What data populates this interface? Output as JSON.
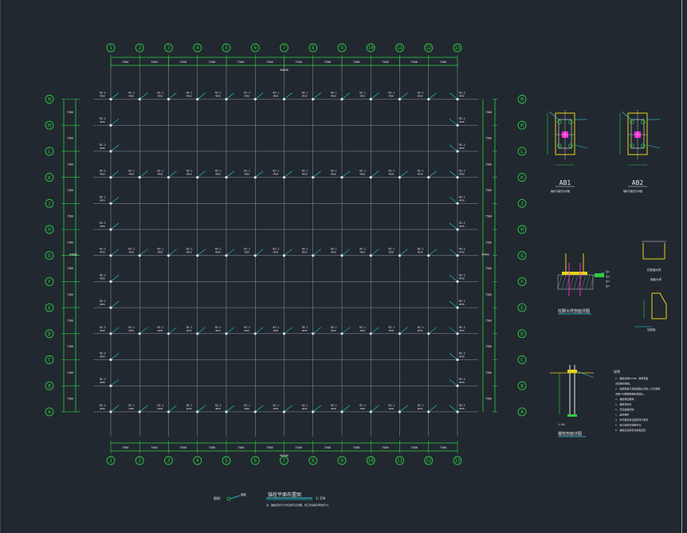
{
  "drawing": {
    "columns": [
      "1",
      "2",
      "3",
      "4",
      "5",
      "6",
      "7",
      "8",
      "9",
      "10",
      "11",
      "12",
      "13"
    ],
    "rows_top_to_bottom": [
      "N",
      "M",
      "L",
      "K",
      "J",
      "H",
      "G",
      "F",
      "E",
      "D",
      "C",
      "B",
      "A"
    ],
    "bay_dim_top": [
      "7500",
      "7500",
      "7500",
      "7500",
      "7500",
      "7500",
      "7500",
      "7500",
      "7500",
      "7500",
      "7500",
      "7500"
    ],
    "bay_dim_bottom": [
      "7500",
      "7500",
      "7500",
      "7500",
      "7500",
      "7500",
      "7500",
      "7500",
      "7500",
      "7500",
      "7500",
      "7500"
    ],
    "overall_dim": "90000",
    "row_dim": "7500",
    "overall_row_dim": "84000",
    "bolt_tag": "RZ-1",
    "bolt_tag_edge": "RZ-2",
    "bolt_callout": "4M30",
    "plan_title": "锚栓平面布置图",
    "plan_scale": "1:150",
    "plan_note": "注：锚栓定位尺寸详见各节点详图，施工时请核对现场尺寸。",
    "legend_mark": "锚栓",
    "legend_label": "图例："
  },
  "details": {
    "ab1_label": "AB1",
    "ab2_label": "AB2",
    "ab1_note": "锚栓平面定位详图",
    "ab2_note": "锚栓平面定位详图",
    "base_section_title": "柱脚大样剖面详图",
    "anchor_detail_title": "锚栓剖面详图",
    "anchor_detail_sub": "1:20",
    "small_title_1": "抗剪键大样",
    "small_title_2": "钢板大样",
    "small_title_3": "加劲板",
    "notes_header": "说明",
    "notes": [
      "1. 锚栓材质Q345B，螺母垫板",
      "   详见相关规范。",
      "2. 柱脚底板与基础顶面之间的二次浇灌层",
      "   采用C40微膨胀细石混凝土。",
      "3. 锚栓埋设要求：",
      "   a. 锚栓顶标高",
      "   b. 定位偏差控制",
      "   c. 丝扣保护",
      "4. 未尽事宜参见国家现行规范",
      "5. 施工前核对柱脚节点",
      "6. 锚栓应采用定位模板固定"
    ]
  },
  "colors": {
    "background": "#212830",
    "axis_green": "#2ecc40",
    "grid_gray": "#8f959c",
    "text_white": "#e8e8e8",
    "leader_cyan": "#2ad4e0",
    "magenta": "#ff2bd8",
    "detail_yellow": "#e8d21a",
    "hatch_gray": "#9a9a9a"
  }
}
